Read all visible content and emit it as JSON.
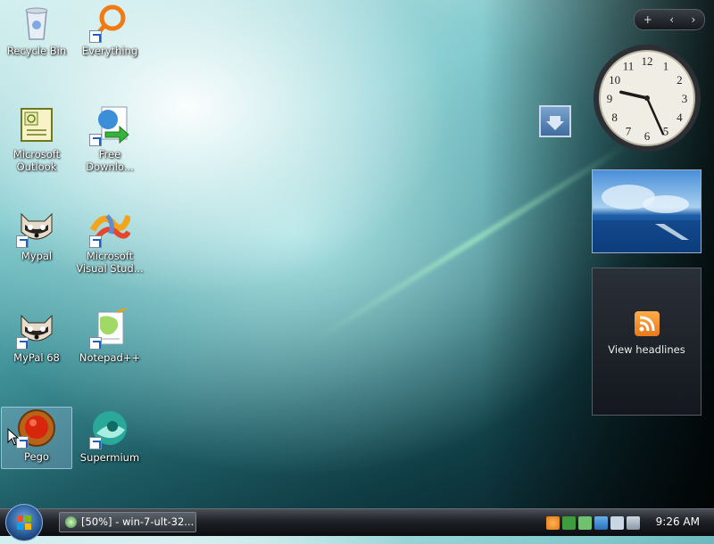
{
  "desktop": {
    "icons": [
      {
        "label": "Recycle Bin"
      },
      {
        "label": "Everything"
      },
      {
        "label": "Microsoft Outlook"
      },
      {
        "label": "Free Downlo..."
      },
      {
        "label": "Mypal"
      },
      {
        "label": "Microsoft Visual Stud..."
      },
      {
        "label": "MyPal 68"
      },
      {
        "label": "Notepad++"
      },
      {
        "label": "Pego"
      },
      {
        "label": "Supermium"
      }
    ]
  },
  "gadgets": {
    "toolbar": {
      "add": "+",
      "prev": "‹",
      "next": "›"
    },
    "clock": {
      "time": "9:26",
      "hour": 9,
      "minute": 26
    },
    "feed": {
      "label": "View headlines"
    }
  },
  "taskbar": {
    "window_button": "[50%] - win-7-ult-32...",
    "time": "9:26 AM"
  }
}
